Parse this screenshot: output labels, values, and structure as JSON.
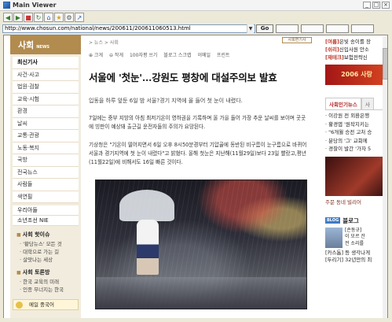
{
  "window": {
    "title": "Main Viewer",
    "min": "_",
    "max": "□",
    "close": "×"
  },
  "toolbar": {
    "icons": [
      "back-icon",
      "forward-icon",
      "stop-icon",
      "refresh-icon",
      "home-icon",
      "favorites-icon",
      "tools-icon",
      "links-icon"
    ]
  },
  "address": {
    "url": "http://www.chosun.com/national/news/200611/200611060513.html",
    "go_label": "Go"
  },
  "leftnav": {
    "section_title": "사회",
    "section_en": "NEWS",
    "items": [
      "최신기사",
      "사건·사고",
      "법원·검찰",
      "교육·시험",
      "환경",
      "날씨",
      "교통·관광",
      "노동·복지",
      "국방",
      "전국뉴스",
      "사람들",
      "색연필"
    ],
    "items2": [
      "우리아들",
      "소년조선 NIE"
    ],
    "hot_head": "사회 핫이슈",
    "hot_items": [
      "'황당뉴스' 모든 것",
      "대학으로 가는 길",
      "살맛나는 세상"
    ],
    "forum_head": "사회 토론방",
    "forum_items": [
      "한국 교육의 미래",
      "인종 무너지는 한국"
    ],
    "promo": "메일 중국어"
  },
  "article": {
    "breadcrumb": "> 뉴스 > 사회",
    "toolbar": [
      "⊕ 크게",
      "⊖ 작게",
      "100자평 쓰기",
      "블로그 스크랩",
      "이메일",
      "프린트"
    ],
    "back_label": "사회면기사",
    "headline": "서울에 '첫눈'…강원도 평창에 대설주의보 발효",
    "sub": "입동을 하루 앞둔 6일 밤 서울?경기 지역에 올 들어 첫 눈이 내렸다.",
    "para1": "7일에는 중부 지방의 아침 최저기온이 영하권을 기록하며 올 가을 들어 가장 추운 날씨를 보이며 곳곳에 빙판이 예상돼 출근길 운전자들의 주의가 요망된다.",
    "para2": "기상청은 \"기온이 떨어지면서 6일 오후 8시50분경부터 기압골에 동반된 비구름이 눈구름으로 바뀌어 서울과 경기지역에 첫 눈이 내렸다\"고 밝혔다. 올해 첫눈은 지난해(11월29일)보다 23일 빨랐고,평년(11월22일)에 비해서도 16일 빠른 것이다."
  },
  "rightcol": {
    "top_items": [
      {
        "tag": "[여름]",
        "text": "은빛 송이를 장"
      },
      {
        "tag": "[쉬리]",
        "text": "신입사원 안소"
      },
      {
        "tag": "[재테크]",
        "text": "보험전략신"
      }
    ],
    "banner": "2006 사랑",
    "tab_active": "사회인기뉴스",
    "tab_other": "사",
    "popular": [
      "이강원 전 외환은행",
      "황경엽 '원작지키는",
      "\"6개월 승전 고처 승",
      "분당의 '그' 교회에",
      "경찰이 발간 '가자 5"
    ],
    "ad_caption": "주문 동네 빌리어",
    "blog_badge": "BLOG",
    "blog_title": "블로그",
    "blog_text": [
      "[손동규]",
      "이 모르 잔",
      "전 소리를"
    ],
    "blog_list": [
      "[카스톰] 등 생각나게",
      "[두리기] 32년만의 최"
    ]
  }
}
